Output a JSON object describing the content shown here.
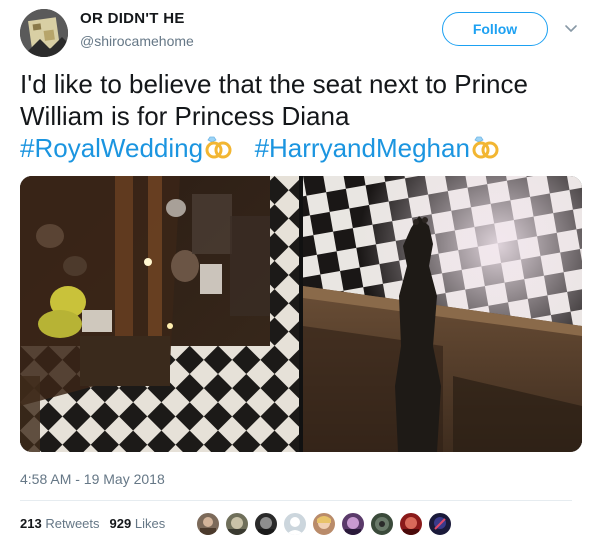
{
  "user": {
    "display_name": "OR DIDN'T HE",
    "handle": "@shirocamehome"
  },
  "follow_button": {
    "label": "Follow"
  },
  "tweet": {
    "line1": "I'd like to believe that the seat next to Prince",
    "line2": "William is for Princess Diana",
    "hashtag1": "#RoyalWedding",
    "hashtag2": "#HarryandMeghan"
  },
  "timestamp": "4:58 AM - 19 May 2018",
  "stats": {
    "retweets_count": "213",
    "retweets_label": "Retweets",
    "likes_count": "929",
    "likes_label": "Likes"
  },
  "colors": {
    "accent": "#1da1f2",
    "hashtag": "#1b95e0",
    "muted": "#657786"
  },
  "icons": [
    "chevron-down-icon",
    "rings-emoji-icon"
  ]
}
